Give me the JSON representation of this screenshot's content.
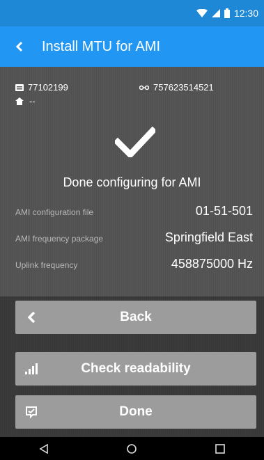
{
  "status_bar": {
    "time": "12:30",
    "icons": [
      "wifi-icon",
      "cell-signal-icon",
      "battery-icon"
    ]
  },
  "app_bar": {
    "title": "Install MTU for AMI",
    "back_icon": "chevron-left-icon"
  },
  "device": {
    "mtu_id": "77102199",
    "meter_id": "757623514521",
    "address": "--"
  },
  "status": {
    "message": "Done configuring for AMI"
  },
  "details": [
    {
      "label": "AMI configuration file",
      "value": "01-51-501"
    },
    {
      "label": "AMI frequency package",
      "value": "Springfield East"
    },
    {
      "label": "Uplink frequency",
      "value": "458875000 Hz"
    }
  ],
  "buttons": {
    "back": "Back",
    "check_readability": "Check readability",
    "done": "Done"
  },
  "colors": {
    "status_bar": "#1e88d6",
    "app_bar": "#2196f3",
    "content_bg": "#555555",
    "button_bg": "#9c9c9c",
    "panel_bg": "#3b3b3b"
  }
}
